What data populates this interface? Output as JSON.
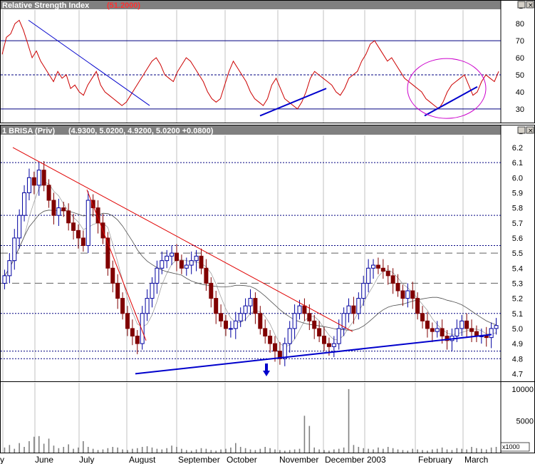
{
  "rsi_panel": {
    "title": "Relative Strength Index",
    "value_text": "(51.2000)",
    "y_ticks": [
      "80",
      "70",
      "60",
      "50",
      "40",
      "30"
    ]
  },
  "price_panel": {
    "title": "1 BRISA (Priv)",
    "ohlc_text": "(4.9300, 5.0200, 4.9200, 5.0200 +0.0800)",
    "y_ticks": [
      "6.2",
      "6.1",
      "6.0",
      "5.9",
      "5.8",
      "5.7",
      "5.6",
      "5.5",
      "5.4",
      "5.3",
      "5.2",
      "5.1",
      "5.0",
      "4.9",
      "4.8",
      "4.7"
    ]
  },
  "volume_panel": {
    "y_ticks": [
      "10000",
      "5000"
    ],
    "multiplier": "x1000"
  },
  "x_labels": [
    "y",
    "June",
    "July",
    "August",
    "September",
    "October",
    "November",
    "December",
    "2003",
    "February",
    "March"
  ],
  "colors": {
    "rsi_line": "#cc0000",
    "candle_up": "#0000a0",
    "candle_down": "#800000",
    "trend_red": "#e00000",
    "trend_blue": "#0000cc",
    "highlight": "#cc00cc",
    "header": "#808080"
  },
  "chart_data": [
    {
      "type": "line",
      "title": "Relative Strength Index",
      "series": [
        {
          "name": "Relative Strength Index",
          "values": [
            62,
            72,
            74,
            80,
            82,
            76,
            68,
            60,
            64,
            58,
            54,
            50,
            46,
            52,
            48,
            50,
            42,
            44,
            40,
            38,
            44,
            48,
            52,
            44,
            40,
            38,
            36,
            34,
            32,
            34,
            38,
            42,
            46,
            50,
            54,
            58,
            60,
            56,
            50,
            48,
            46,
            52,
            56,
            60,
            58,
            54,
            50,
            46,
            40,
            36,
            34,
            36,
            44,
            52,
            58,
            54,
            50,
            46,
            40,
            36,
            34,
            32,
            36,
            44,
            48,
            42,
            36,
            34,
            32,
            30,
            34,
            40,
            48,
            52,
            50,
            48,
            46,
            44,
            40,
            38,
            42,
            48,
            50,
            52,
            58,
            62,
            68,
            70,
            66,
            62,
            58,
            60,
            56,
            52,
            48,
            46,
            44,
            42,
            40,
            36,
            34,
            32,
            30,
            34,
            40,
            44,
            46,
            48,
            50,
            44,
            38,
            40,
            46,
            50,
            48,
            46,
            52
          ]
        }
      ],
      "ylim": [
        22,
        88
      ],
      "y_ticks": [
        80,
        70,
        60,
        50,
        40,
        30
      ],
      "reference_lines": [
        70,
        50,
        30
      ]
    },
    {
      "type": "candlestick",
      "title": "1 BRISA (Priv)",
      "ohlc_last": {
        "open": 4.93,
        "high": 5.02,
        "low": 4.92,
        "close": 5.02,
        "change": 0.08
      },
      "close": [
        5.35,
        5.45,
        5.6,
        5.75,
        5.9,
        6.0,
        5.95,
        6.05,
        5.95,
        5.85,
        5.75,
        5.8,
        5.78,
        5.7,
        5.65,
        5.6,
        5.55,
        5.85,
        5.8,
        5.7,
        5.6,
        5.4,
        5.3,
        5.2,
        5.1,
        5.0,
        4.95,
        4.9,
        5.1,
        5.2,
        5.3,
        5.4,
        5.45,
        5.48,
        5.5,
        5.45,
        5.4,
        5.42,
        5.45,
        5.48,
        5.4,
        5.3,
        5.2,
        5.1,
        5.05,
        5.0,
        5.0,
        5.05,
        5.1,
        5.15,
        5.2,
        5.1,
        5.0,
        4.95,
        4.9,
        4.85,
        4.8,
        4.9,
        5.0,
        5.1,
        5.15,
        5.1,
        5.05,
        5.0,
        4.95,
        4.9,
        4.88,
        4.9,
        5.0,
        5.1,
        5.15,
        5.1,
        5.2,
        5.3,
        5.4,
        5.42,
        5.4,
        5.38,
        5.35,
        5.3,
        5.25,
        5.2,
        5.25,
        5.2,
        5.1,
        5.05,
        5.0,
        4.98,
        5.0,
        4.95,
        4.92,
        4.95,
        5.0,
        5.05,
        5.0,
        4.98,
        4.95,
        4.95,
        4.94,
        5.0,
        5.02
      ],
      "ylim": [
        4.65,
        6.28
      ],
      "y_ticks": [
        6.2,
        6.1,
        6.0,
        5.9,
        5.8,
        5.7,
        5.6,
        5.5,
        5.4,
        5.3,
        5.2,
        5.1,
        5.0,
        4.9,
        4.8,
        4.7
      ],
      "horizontal_levels": [
        6.1,
        5.75,
        5.55,
        5.5,
        5.3,
        5.1,
        4.85,
        4.8
      ]
    },
    {
      "type": "bar",
      "title": "Volume",
      "values": [
        800,
        1200,
        600,
        1500,
        900,
        1800,
        2500,
        2600,
        1400,
        2200,
        1100,
        700,
        900,
        1300,
        600,
        800,
        1800,
        900,
        600,
        400,
        500,
        700,
        900,
        800,
        500,
        400,
        600,
        700,
        900,
        1000,
        800,
        600,
        500,
        700,
        1100,
        900,
        600,
        400,
        300,
        500,
        700,
        600,
        400,
        300,
        500,
        600,
        800,
        1500,
        900,
        700,
        500,
        400,
        600,
        900,
        700,
        500,
        400,
        300,
        400,
        500,
        600,
        5800,
        4200,
        800,
        500,
        400,
        300,
        500,
        600,
        800,
        10000,
        1200,
        900,
        700,
        600,
        500,
        800,
        600,
        900,
        700,
        500,
        400,
        300,
        600,
        500,
        400,
        300,
        500,
        600,
        800,
        500,
        400,
        700,
        600,
        500,
        900,
        700,
        600,
        500,
        800,
        900
      ],
      "ylim": [
        0,
        11000
      ],
      "y_ticks": [
        10000,
        5000
      ]
    }
  ]
}
